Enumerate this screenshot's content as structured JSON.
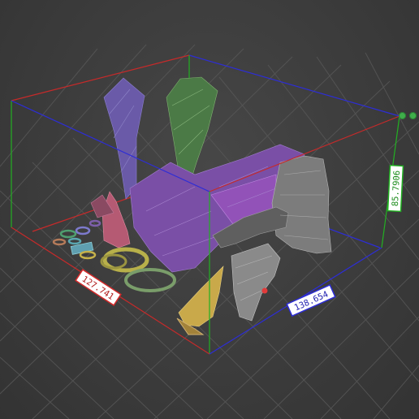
{
  "viewport": {
    "dimensions": {
      "x": "138.654",
      "y": "85.7906",
      "z": "127.741"
    }
  },
  "colors": {
    "background": "#3b3b3b",
    "grid": "#555555",
    "axis_x_edge": "#d42a2a",
    "axis_y_edge": "#2d2dd6",
    "axis_z_edge": "#22b022",
    "label_x_border": "#2d2dd6",
    "label_y_border": "#22b022",
    "label_z_border": "#d42a2a"
  },
  "icons": [
    "view-toggle-icon",
    "view-toggle-icon"
  ]
}
